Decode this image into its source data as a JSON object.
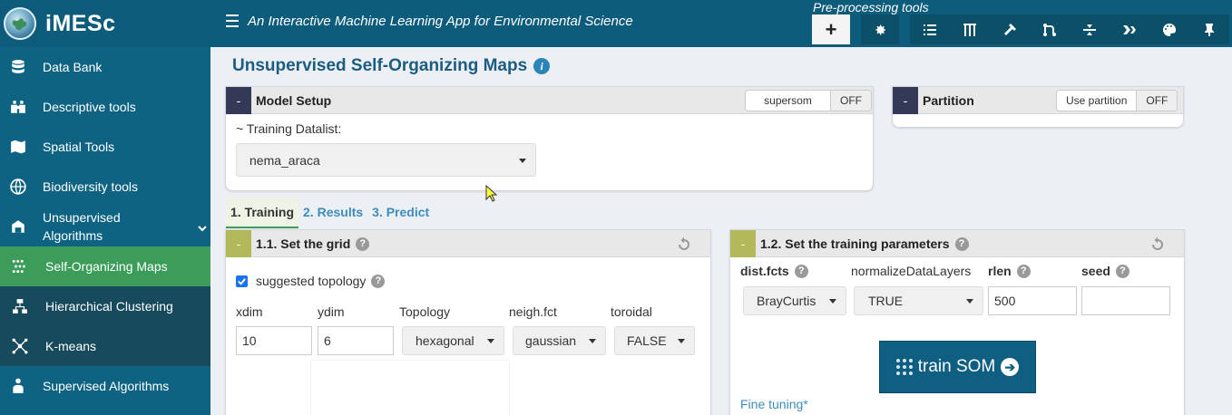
{
  "app": {
    "name": "iMESc",
    "title": "An Interactive Machine Learning App for Environmental Science"
  },
  "toolbar": {
    "section_label": "Pre-processing tools",
    "plus_label": "+"
  },
  "sidebar": {
    "items": [
      {
        "label": "Data Bank",
        "icon": "database-icon"
      },
      {
        "label": "Descriptive tools",
        "icon": "binoculars-icon"
      },
      {
        "label": "Spatial Tools",
        "icon": "map-icon"
      },
      {
        "label": "Biodiversity tools",
        "icon": "globe-icon"
      },
      {
        "label": "Unsupervised Algorithms",
        "icon": "unsupervised-icon"
      },
      {
        "label": "Supervised Algorithms",
        "icon": "supervised-icon"
      }
    ],
    "subitems": [
      {
        "label": "Self-Organizing Maps",
        "icon": "grid-dots-icon",
        "active": true
      },
      {
        "label": "Hierarchical Clustering",
        "icon": "hierarchy-icon"
      },
      {
        "label": "K-means",
        "icon": "kmeans-icon"
      }
    ]
  },
  "page": {
    "title": "Unsupervised Self-Organizing Maps"
  },
  "model_setup": {
    "collapse": "-",
    "title": "Model Setup",
    "toggle_on": "supersom",
    "toggle_off": "OFF",
    "datalist_label": "~ Training Datalist:",
    "datalist_value": "nema_araca"
  },
  "partition": {
    "collapse": "-",
    "title": "Partition",
    "toggle_on": "Use partition",
    "toggle_off": "OFF"
  },
  "tabs": [
    {
      "label": "1. Training",
      "active": true
    },
    {
      "label": "2. Results"
    },
    {
      "label": "3. Predict"
    }
  ],
  "grid_box": {
    "collapse": "-",
    "title": "1.1. Set the grid",
    "suggested_label": "suggested topology",
    "suggested_checked": true,
    "xdim_label": "xdim",
    "xdim_value": "10",
    "ydim_label": "ydim",
    "ydim_value": "6",
    "topology_label": "Topology",
    "topology_value": "hexagonal",
    "neigh_label": "neigh.fct",
    "neigh_value": "gaussian",
    "toroidal_label": "toroidal",
    "toroidal_value": "FALSE"
  },
  "training_box": {
    "collapse": "-",
    "title": "1.2. Set the training parameters",
    "dist_label": "dist.fcts",
    "dist_value": "BrayCurtis",
    "normalize_label": "normalizeDataLayers",
    "normalize_value": "TRUE",
    "rlen_label": "rlen",
    "rlen_value": "500",
    "seed_label": "seed",
    "seed_value": "",
    "train_button": "train SOM",
    "fine_tuning": "Fine tuning*"
  },
  "colors": {
    "header": "#0d5c7c",
    "sidebar": "#0e6383",
    "active": "#3c9d5a",
    "accent": "#3c8dbc"
  }
}
